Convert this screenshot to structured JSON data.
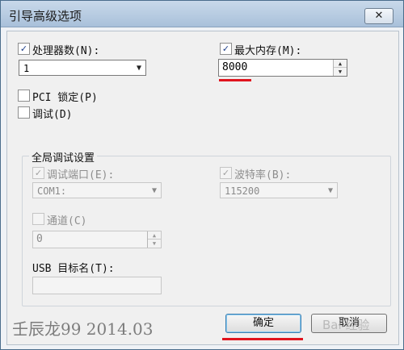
{
  "window": {
    "title": "引导高级选项",
    "close_glyph": "✕"
  },
  "processors": {
    "checkbox_label": "处理器数(N):",
    "checked": true,
    "value": "1"
  },
  "max_memory": {
    "checkbox_label": "最大内存(M):",
    "checked": true,
    "value": "8000"
  },
  "pci_lock": {
    "label": "PCI 锁定(P)",
    "checked": false
  },
  "debug": {
    "label": "调试(D)",
    "checked": false
  },
  "global_debug": {
    "title": "全局调试设置",
    "debug_port": {
      "label": "调试端口(E):",
      "checked": true,
      "value": "COM1:"
    },
    "baud_rate": {
      "label": "波特率(B):",
      "checked": true,
      "value": "115200"
    },
    "channel": {
      "label": "通道(C)",
      "checked": false,
      "value": "0"
    },
    "usb_target": {
      "label": "USB 目标名(T):",
      "value": ""
    }
  },
  "buttons": {
    "ok": "确定",
    "cancel": "取消"
  },
  "glyphs": {
    "check": "✓",
    "dropdown": "▼",
    "spin_up": "▲",
    "spin_down": "▼"
  },
  "overlay": {
    "signature": "壬辰龙99 2014.03",
    "watermark": "Bai 经验"
  },
  "colors": {
    "annotation_red": "#e0141e",
    "titlebar": "#b9cde3"
  }
}
